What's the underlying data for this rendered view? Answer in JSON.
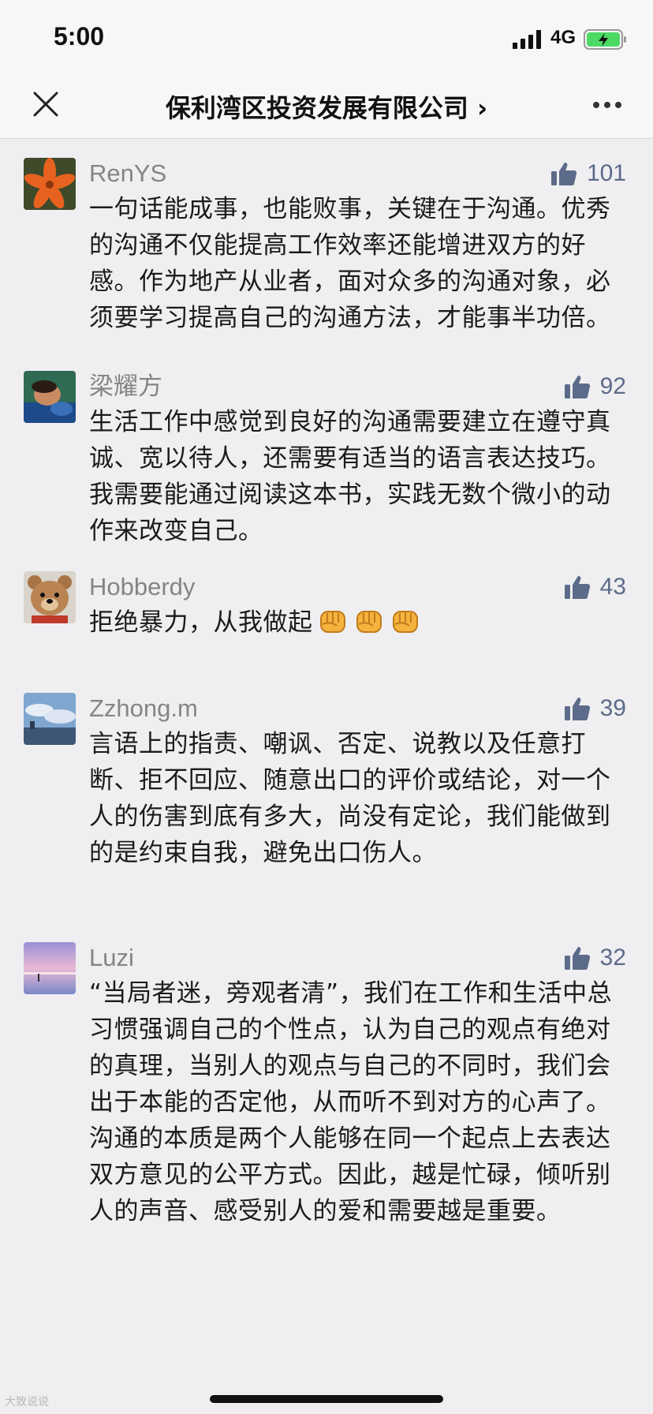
{
  "status_bar": {
    "time": "5:00",
    "network": "4G",
    "icons": [
      "signal-icon",
      "battery-charging-icon"
    ]
  },
  "nav": {
    "title": "保利湾区投资发展有限公司 ›",
    "icons": [
      "close-icon",
      "more-icon"
    ]
  },
  "comments": [
    {
      "name": "RenYS",
      "likes": "101",
      "avatar": "orange-lily-avatar",
      "text": "一句话能成事，也能败事，关键在于沟通。优秀的沟通不仅能提高工作效率还能增进双方的好感。作为地产从业者，面对众多的沟通对象，必须要学习提高自己的沟通方法，才能事半功倍。"
    },
    {
      "name": "梁耀方",
      "likes": "92",
      "avatar": "sleeping-person-avatar",
      "text": "生活工作中感觉到良好的沟通需要建立在遵守真诚、宽以待人，还需要有适当的语言表达技巧。我需要能通过阅读这本书，实践无数个微小的动作来改变自己。"
    },
    {
      "name": "Hobberdy",
      "likes": "43",
      "avatar": "teddy-bear-avatar",
      "text": "拒绝暴力，从我做起"
    },
    {
      "name": "Zzhong.m",
      "likes": "39",
      "avatar": "sky-landscape-avatar",
      "text": "言语上的指责、嘲讽、否定、说教以及任意打断、拒不回应、随意出口的评价或结论，对一个人的伤害到底有多大，尚没有定论，我们能做到的是约束自我，避免出口伤人。"
    },
    {
      "name": "Luzi",
      "likes": "32",
      "avatar": "purple-sunset-avatar",
      "text": "“当局者迷，旁观者清”，我们在工作和生活中总习惯强调自己的个性点，认为自己的观点有绝对的真理，当别人的观点与自己的不同时，我们会出于本能的否定他，从而听不到对方的心声了。沟通的本质是两个人能够在同一个起点上去表达双方意见的公平方式。因此，越是忙碌，倾听别人的声音、感受别人的爱和需要越是重要。"
    }
  ],
  "watermark": "大致说说",
  "colors": {
    "background": "#efeff1",
    "like_blue": "#5d6b8a",
    "name_gray": "#858585"
  }
}
